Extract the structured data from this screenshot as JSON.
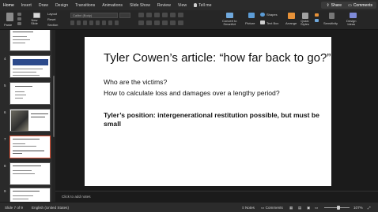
{
  "ribbon_tabs": [
    "Home",
    "Insert",
    "Draw",
    "Design",
    "Transitions",
    "Animations",
    "Slide Show",
    "Review",
    "View"
  ],
  "tell_me": "Tell me",
  "share_label": "Share",
  "comments_label": "Comments",
  "ribbon": {
    "paste": "Paste",
    "new_slide": "New\nSlide",
    "layout": "Layout",
    "reset": "Reset",
    "section": "Section",
    "font_name": "Calibri (Body)",
    "picture": "Picture",
    "shapes": "Shapes",
    "text_box": "Text Box",
    "arrange": "Arrange",
    "quick_styles": "Quick\nStyles",
    "convert_smartart": "Convert to\nSmartArt",
    "sensitivity": "Sensitivity",
    "design_ideas": "Design\nIdeas",
    "accent_color": "#e0553a"
  },
  "thumbnails": [
    {
      "num": "",
      "selected": false
    },
    {
      "num": "4",
      "selected": false
    },
    {
      "num": "5",
      "selected": false
    },
    {
      "num": "6",
      "selected": false
    },
    {
      "num": "7",
      "selected": true
    },
    {
      "num": "8",
      "selected": false
    },
    {
      "num": "9",
      "selected": false
    }
  ],
  "slide": {
    "title": "Tyler Cowen’s article: “how far back to go?”",
    "bullet1": "Who are the victims?",
    "bullet2": "How to calculate loss and damages over a lengthy period?",
    "bullet3": "Tyler’s position: intergenerational restitution possible, but must be small"
  },
  "notes_placeholder": "Click to add notes",
  "status": {
    "slide_of": "Slide 7 of 9",
    "language": "English (United States)",
    "notes": "Notes",
    "comments": "Comments",
    "zoom": "107%"
  }
}
